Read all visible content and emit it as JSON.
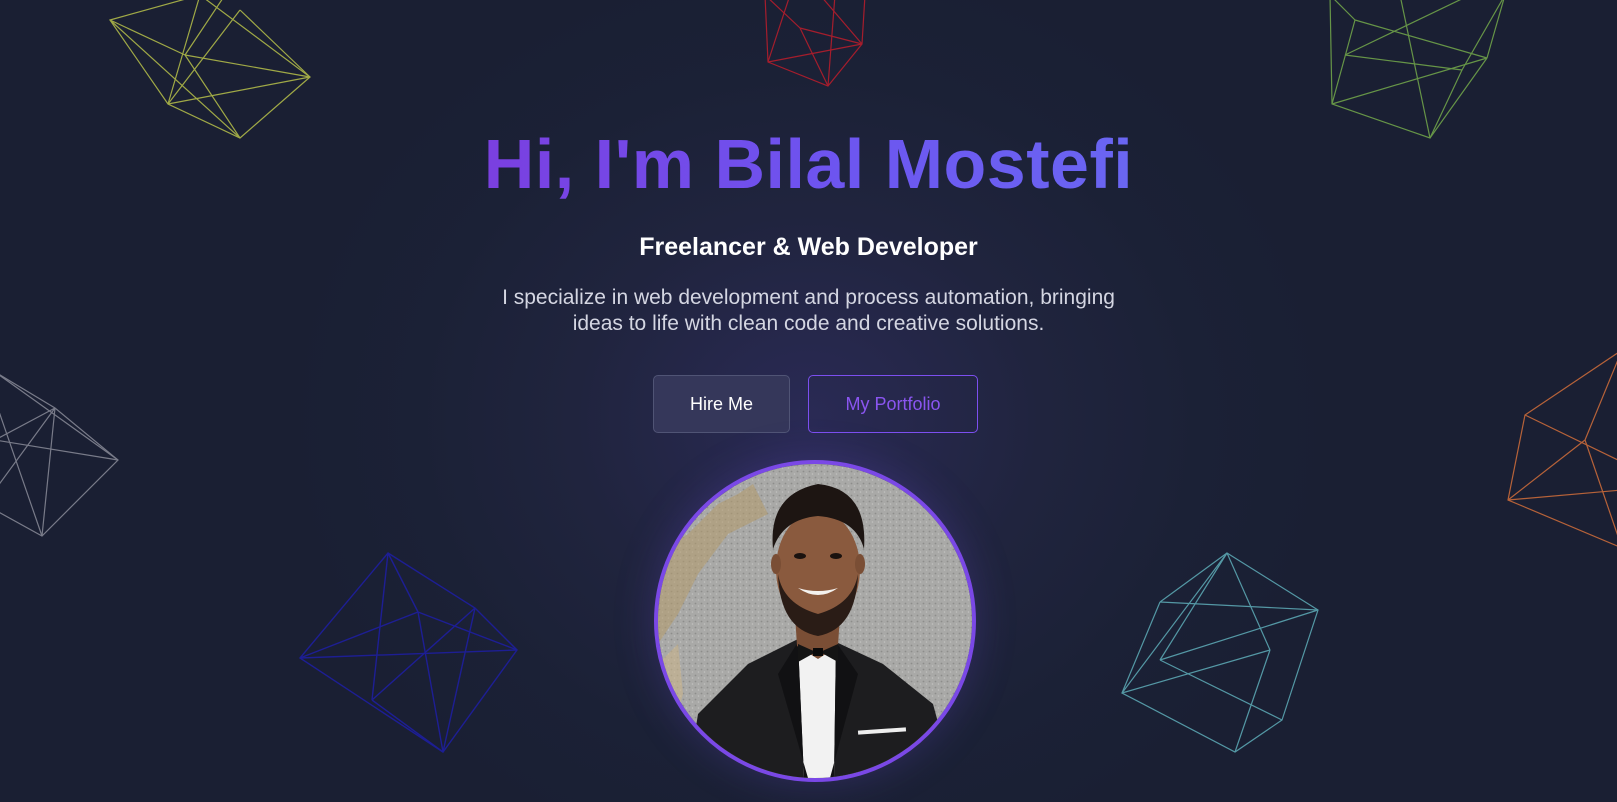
{
  "hero": {
    "title": "Hi, I'm Bilal Mostefi",
    "subtitle": "Freelancer & Web Developer",
    "description": "I specialize in web development and process automation, bringing ideas to life with clean code and creative solutions."
  },
  "buttons": {
    "hire_label": "Hire Me",
    "portfolio_label": "My Portfolio"
  },
  "colors": {
    "background": "#1b2136",
    "accent": "#7a48e6",
    "title_gradient_start": "#7a3fe0",
    "title_gradient_end": "#6a66f2"
  },
  "decorations": [
    {
      "name": "yellow-wireframe-cube-icon",
      "color": "#b8c24a"
    },
    {
      "name": "red-wireframe-cube-icon",
      "color": "#b51d2c"
    },
    {
      "name": "green-wireframe-cube-icon",
      "color": "#6fa24a"
    },
    {
      "name": "gray-wireframe-cube-icon",
      "color": "#8a8c99"
    },
    {
      "name": "orange-wireframe-cube-icon",
      "color": "#c86a3a"
    },
    {
      "name": "blue-wireframe-cube-icon",
      "color": "#1e1e9a"
    },
    {
      "name": "teal-wireframe-cube-icon",
      "color": "#5ba6b2"
    }
  ]
}
